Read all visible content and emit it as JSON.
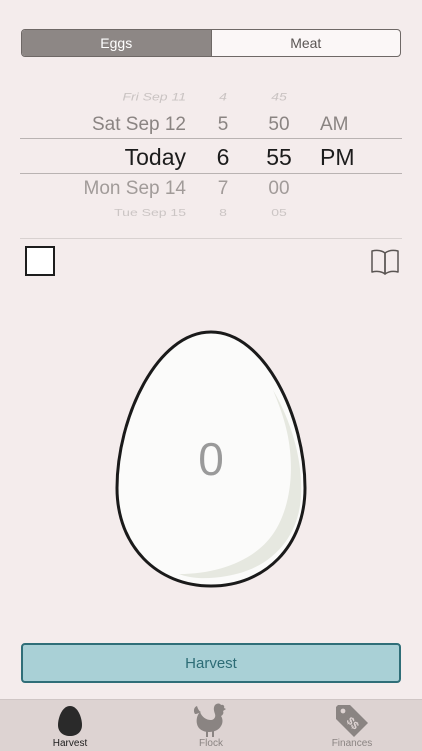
{
  "segmented": {
    "options": [
      {
        "label": "Eggs",
        "selected": true
      },
      {
        "label": "Meat",
        "selected": false
      }
    ]
  },
  "picker": {
    "rows": [
      {
        "date": "Fri Sep 11",
        "hour": "4",
        "minute": "45",
        "ampm": ""
      },
      {
        "date": "Sat Sep 12",
        "hour": "5",
        "minute": "50",
        "ampm": "AM"
      },
      {
        "date": "Today",
        "hour": "6",
        "minute": "55",
        "ampm": "PM"
      },
      {
        "date": "Mon Sep 14",
        "hour": "7",
        "minute": "00",
        "ampm": ""
      },
      {
        "date": "Tue Sep 15",
        "hour": "8",
        "minute": "05",
        "ampm": ""
      }
    ]
  },
  "options": {
    "checkbox_checked": false,
    "book_icon": "book-icon"
  },
  "egg": {
    "count": "0"
  },
  "harvest_button": {
    "label": "Harvest"
  },
  "tabbar": {
    "tabs": [
      {
        "label": "Harvest",
        "icon": "egg-icon",
        "active": true
      },
      {
        "label": "Flock",
        "icon": "chicken-icon",
        "active": false
      },
      {
        "label": "Finances",
        "icon": "price-tag-icon",
        "active": false
      }
    ]
  },
  "colors": {
    "background": "#f4ecec",
    "segment_active": "#8d8785",
    "harvest_fill": "#a9d0d6",
    "harvest_border": "#2f6e78",
    "tabbar": "#ddd3d2"
  }
}
